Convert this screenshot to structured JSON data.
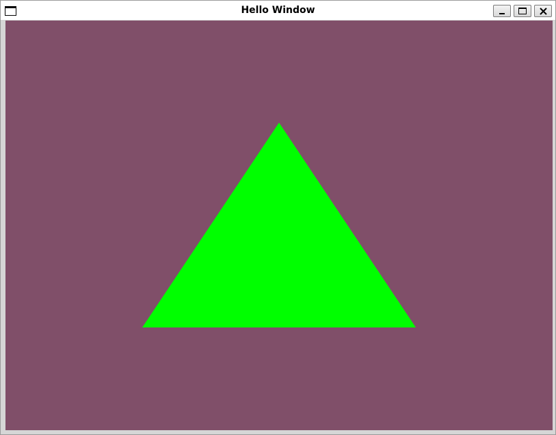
{
  "window": {
    "title": "Hello Window",
    "icon": "window-icon",
    "controls": {
      "minimize_icon": "minimize-icon",
      "maximize_icon": "maximize-icon",
      "close_icon": "close-icon"
    }
  },
  "canvas": {
    "clear_color": "#804f69",
    "shape": "triangle",
    "shape_color": "#00ff00"
  }
}
